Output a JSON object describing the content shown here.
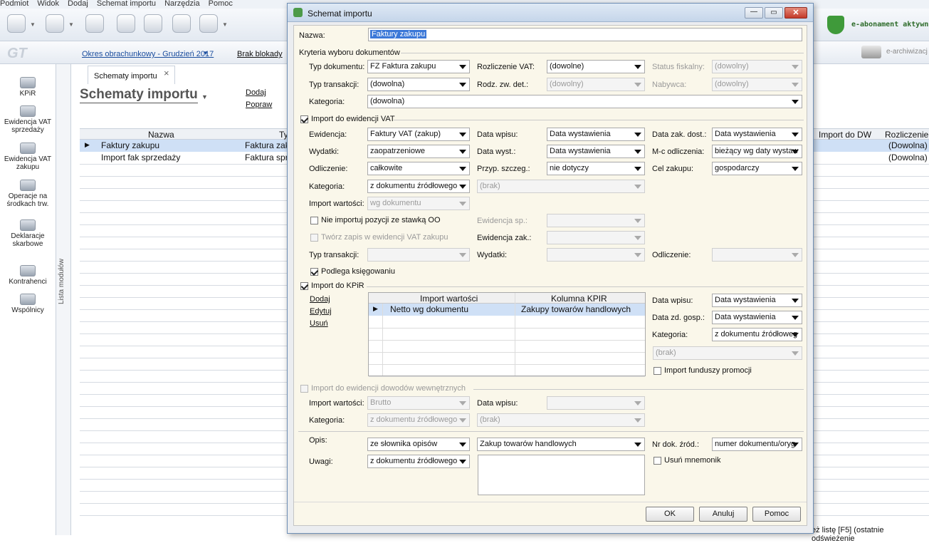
{
  "menu": [
    "Podmiot",
    "Widok",
    "Dodaj",
    "Schemat importu",
    "Narzędzia",
    "Pomoc"
  ],
  "header": {
    "license": "e-abonament aktywn",
    "archive": "e-archiwizacj"
  },
  "subbar": {
    "period": "Okres obrachunkowy - Grudzień 2017",
    "lock": "Brak blokady",
    "tab": "Schematy importu"
  },
  "sidebar": [
    "KPiR",
    "Ewidencja VAT sprzedaży",
    "Ewidencja VAT zakupu",
    "Operacje na środkach trw.",
    "Deklaracje skarbowe",
    "Kontrahenci",
    "Wspólnicy"
  ],
  "sidebar_lines": [
    [
      "KPiR"
    ],
    [
      "Ewidencja VAT",
      "sprzedaży"
    ],
    [
      "Ewidencja VAT",
      "zakupu"
    ],
    [
      "Operacje na",
      "środkach trw."
    ],
    [
      "Deklaracje",
      "skarbowe"
    ],
    [
      "Kontrahenci"
    ],
    [
      "Wspólnicy"
    ]
  ],
  "modules_label": "Lista modułów",
  "page": {
    "title": "Schematy importu",
    "add": "Dodaj",
    "edit": "Popraw"
  },
  "table": {
    "headers": [
      "Nazwa",
      "Ty",
      "Import do DW",
      "Rozliczenie"
    ],
    "rows": [
      [
        "Faktury zakupu",
        "Faktura zak",
        "(Dowolna)"
      ],
      [
        "Import fak sprzedaży",
        "Faktura spr",
        "(Dowolna)"
      ]
    ]
  },
  "status": "eż listę [F5] (ostatnie odświeżenie",
  "dialog": {
    "title": "Schemat importu",
    "name_label": "Nazwa:",
    "name_value": "Faktury zakupu",
    "criteria": {
      "section": "Kryteria wyboru dokumentów",
      "doc_type_l": "Typ dokumentu:",
      "doc_type": "FZ Faktura zakupu",
      "vat_settle_l": "Rozliczenie VAT:",
      "vat_settle": "(dowolne)",
      "fiscal_l": "Status fiskalny:",
      "fiscal": "(dowolny)",
      "trans_l": "Typ transakcji:",
      "trans": "(dowolna)",
      "exempt_l": "Rodz. zw. det.:",
      "exempt": "(dowolny)",
      "buyer_l": "Nabywca:",
      "buyer": "(dowolny)",
      "cat_l": "Kategoria:",
      "cat": "(dowolna)"
    },
    "vat": {
      "section": "Import do ewidencji VAT",
      "reg_l": "Ewidencja:",
      "reg": "Faktury VAT (zakup)",
      "entry_date_l": "Data wpisu:",
      "entry_date": "Data wystawienia",
      "buy_date_l": "Data zak. dost.:",
      "buy_date": "Data wystawienia",
      "exp_l": "Wydatki:",
      "exp": "zaopatrzeniowe",
      "issue_date_l": "Data wyst.:",
      "issue_date": "Data wystawienia",
      "month_l": "M-c odliczenia:",
      "month": "bieżący wg daty wystaw",
      "deduct_l": "Odliczenie:",
      "deduct": "całkowite",
      "special_l": "Przyp. szczeg.:",
      "special": "nie dotyczy",
      "purpose_l": "Cel zakupu:",
      "purpose": "gospodarczy",
      "cat_l": "Kategoria:",
      "cat": "z dokumentu źródłowego",
      "cat2": "(brak)",
      "value_l": "Import wartości:",
      "value": "wg dokumentu",
      "no_oo": "Nie importuj pozycji ze stawką OO",
      "create": "Twórz zapis w ewidencji VAT zakupu",
      "reg_s_l": "Ewidencja sp.:",
      "reg_z_l": "Ewidencja zak.:",
      "trans_l": "Typ transakcji:",
      "exp2_l": "Wydatki:",
      "deduct2_l": "Odliczenie:",
      "posting": "Podlega księgowaniu"
    },
    "kpir": {
      "section": "Import do KPiR",
      "add": "Dodaj",
      "edit": "Edytuj",
      "del": "Usuń",
      "cols": [
        "Import wartości",
        "Kolumna KPIR"
      ],
      "rows": [
        [
          "Netto wg dokumentu",
          "Zakupy towarów handlowych"
        ]
      ],
      "entry_date_l": "Data wpisu:",
      "entry_date": "Data wystawienia",
      "event_date_l": "Data zd. gosp.:",
      "event_date": "Data wystawienia",
      "cat_l": "Kategoria:",
      "cat": "z dokumentu źródłoweg",
      "cat2": "(brak)",
      "promo": "Import funduszy promocji"
    },
    "dw": {
      "section": "Import do ewidencji dowodów wewnętrznych",
      "value_l": "Import wartości:",
      "value": "Brutto",
      "entry_l": "Data wpisu:",
      "cat_l": "Kategoria:",
      "cat": "z dokumentu źródłowego",
      "cat2": "(brak)"
    },
    "desc": {
      "desc_l": "Opis:",
      "desc_src": "ze słownika opisów",
      "desc_val": "Zakup towarów handlowych",
      "docnr_l": "Nr dok. źród.:",
      "docnr": "numer dokumentu/oryg",
      "notes_l": "Uwagi:",
      "notes": "z dokumentu źródłowego",
      "mnemo": "Usuń mnemonik"
    },
    "buttons": {
      "ok": "OK",
      "cancel": "Anuluj",
      "help": "Pomoc"
    }
  }
}
